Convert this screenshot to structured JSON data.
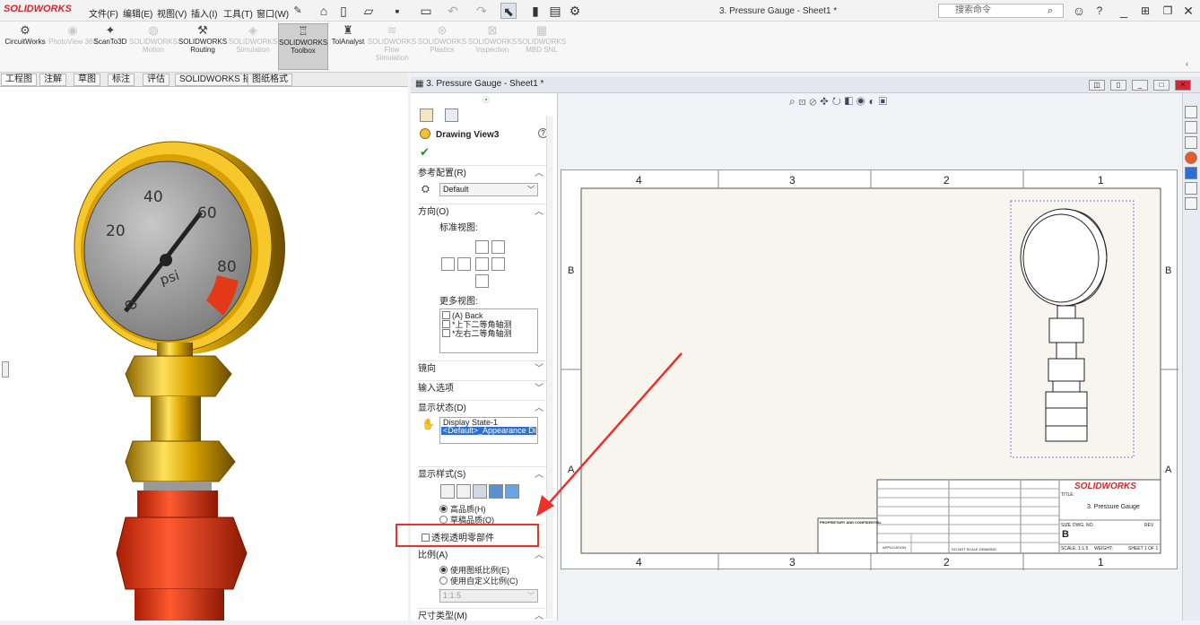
{
  "app": {
    "logo": "SOLIDWORKS",
    "title": "3. Pressure Gauge - Sheet1 *",
    "search_placeholder": "搜索命令"
  },
  "menu": [
    "文件(F)",
    "编辑(E)",
    "视图(V)",
    "插入(I)",
    "工具(T)",
    "窗口(W)"
  ],
  "commands": [
    {
      "label": "CircuitWorks",
      "enabled": true
    },
    {
      "label": "PhotoView 360",
      "enabled": false
    },
    {
      "label": "ScanTo3D",
      "enabled": true
    },
    {
      "label": "SOLIDWORKS Motion",
      "enabled": false
    },
    {
      "label": "SOLIDWORKS Routing",
      "enabled": true
    },
    {
      "label": "SOLIDWORKS Simulation",
      "enabled": false
    },
    {
      "label": "SOLIDWORKS Toolbox",
      "enabled": true,
      "active": true
    },
    {
      "label": "TolAnalyst",
      "enabled": true
    },
    {
      "label": "SOLIDWORKS Flow Simulation",
      "enabled": false
    },
    {
      "label": "SOLIDWORKS Plastics",
      "enabled": false
    },
    {
      "label": "SOLIDWORKS Inspection",
      "enabled": false
    },
    {
      "label": "SOLIDWORKS MBD SNL",
      "enabled": false
    }
  ],
  "tabs": [
    "工程图",
    "注解",
    "草图",
    "标注",
    "评估",
    "SOLIDWORKS 插件",
    "图纸格式"
  ],
  "gauge": {
    "ticks": [
      "0",
      "20",
      "40",
      "60",
      "80"
    ],
    "unit": "psi"
  },
  "doc_tab": "3. Pressure Gauge - Sheet1 *",
  "pm": {
    "title": "Drawing View3",
    "ref_config": {
      "label": "参考配置(R)",
      "value": "Default"
    },
    "orientation": {
      "label": "方向(O)",
      "std_views": "标准视图:",
      "more_views": "更多视图:",
      "views": [
        "(A) Back",
        "*上下二等角轴测",
        "*左右二等角轴测"
      ]
    },
    "mirror": "镜向",
    "import_options": "输入选项",
    "display_state": {
      "label": "显示状态(D)",
      "items": [
        "Display State-1",
        "<Default>_Appearance Displ"
      ]
    },
    "display_style": {
      "label": "显示样式(S)",
      "high_quality": "高品质(H)",
      "draft_quality": "草稿品质(Q)",
      "see_through": "透视透明零部件"
    },
    "scale": {
      "label": "比例(A)",
      "use_sheet": "使用图纸比例(E)",
      "use_custom": "使用自定义比例(C)",
      "value": "1:1.5"
    },
    "dim_type": "尺寸类型(M)"
  },
  "sheet": {
    "col_labels": [
      "4",
      "3",
      "2",
      "1"
    ],
    "row_labels": [
      "B",
      "A"
    ],
    "title_block": {
      "brand": "SOLIDWORKS",
      "title_label": "TITLE:",
      "title": "3. Pressure Gauge",
      "size_label": "SIZE",
      "size": "B",
      "dwg_label": "DWG. NO.",
      "rev_label": "REV",
      "scale": "SCALE: 1:1.5",
      "weight": "WEIGHT:",
      "sheet": "SHEET 1 OF 1",
      "proprietary": "PROPRIETARY AND CONFIDENTIAL",
      "application": "APPLICATION",
      "do_not_scale": "DO NOT SCALE DRAWING"
    }
  },
  "colors": {
    "accent": "#d4262b",
    "highlight_box": "#e8322a",
    "gauge_gold": "#d9a400",
    "gauge_red": "#e23a18"
  }
}
